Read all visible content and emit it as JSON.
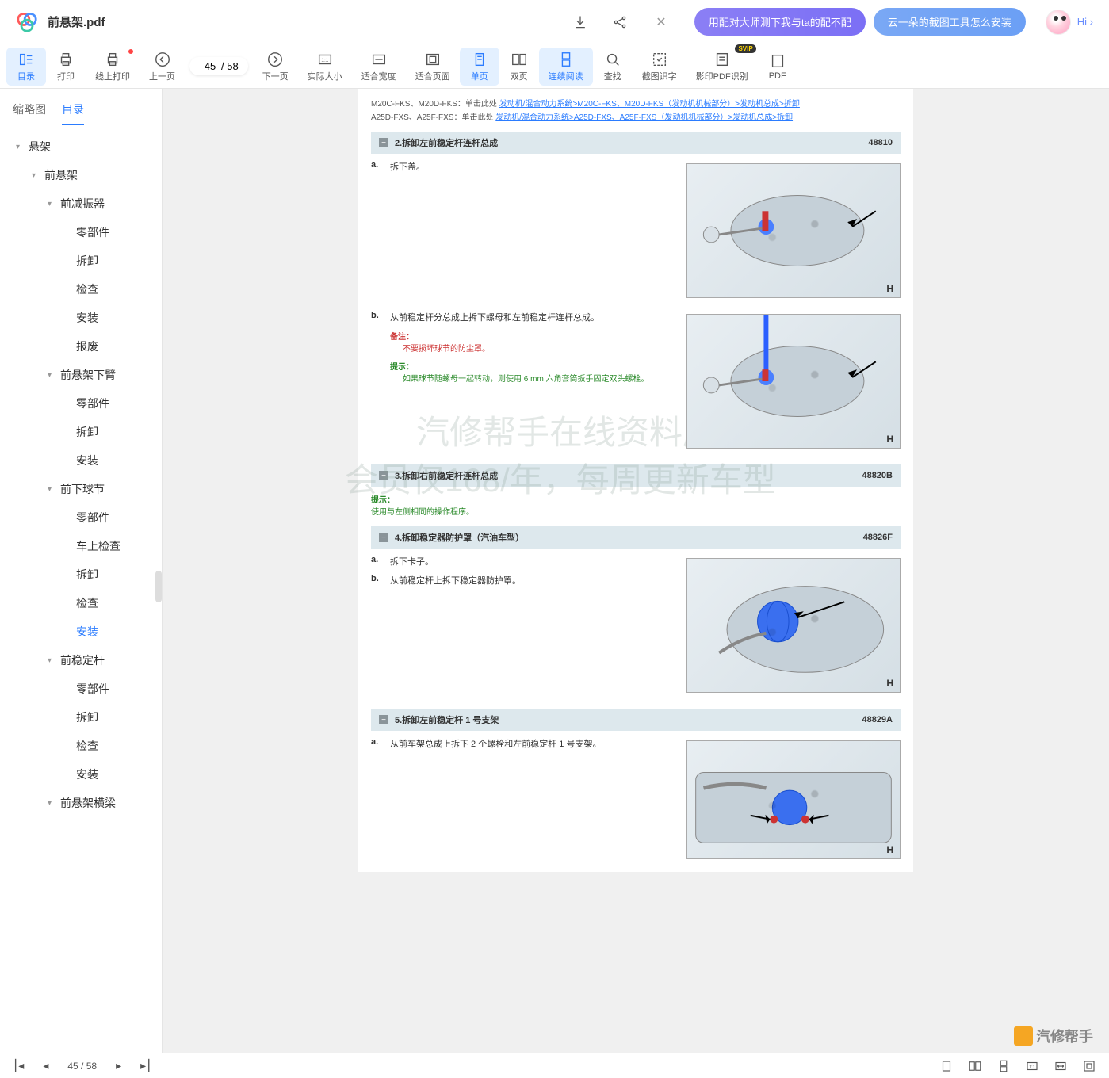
{
  "titlebar": {
    "filename": "前悬架.pdf",
    "promo1": "用配对大师测下我与ta的配不配",
    "promo2": "云一朵的截图工具怎么安装",
    "hi": "Hi"
  },
  "toolbar": {
    "items": [
      {
        "label": "目录",
        "active": true
      },
      {
        "label": "打印"
      },
      {
        "label": "线上打印",
        "dot": true
      },
      {
        "label": "上一页"
      },
      {
        "label": "下一页"
      },
      {
        "label": "实际大小"
      },
      {
        "label": "适合宽度"
      },
      {
        "label": "适合页面"
      },
      {
        "label": "单页",
        "active": true
      },
      {
        "label": "双页"
      },
      {
        "label": "连续阅读",
        "active": true
      },
      {
        "label": "查找"
      },
      {
        "label": "截图识字"
      },
      {
        "label": "影印PDF识别",
        "svip": true
      },
      {
        "label": "PDF"
      }
    ],
    "page_current": "45",
    "page_total": "58"
  },
  "sidebar": {
    "tabs": [
      "缩略图",
      "目录"
    ],
    "active_tab": 1,
    "tree": [
      {
        "level": 0,
        "label": "悬架",
        "caret": true
      },
      {
        "level": 1,
        "label": "前悬架",
        "caret": true
      },
      {
        "level": 2,
        "label": "前减振器",
        "caret": true
      },
      {
        "level": 3,
        "label": "零部件"
      },
      {
        "level": 3,
        "label": "拆卸"
      },
      {
        "level": 3,
        "label": "检查"
      },
      {
        "level": 3,
        "label": "安装"
      },
      {
        "level": 3,
        "label": "报废"
      },
      {
        "level": 2,
        "label": "前悬架下臂",
        "caret": true
      },
      {
        "level": 3,
        "label": "零部件"
      },
      {
        "level": 3,
        "label": "拆卸"
      },
      {
        "level": 3,
        "label": "安装"
      },
      {
        "level": 2,
        "label": "前下球节",
        "caret": true
      },
      {
        "level": 3,
        "label": "零部件"
      },
      {
        "level": 3,
        "label": "车上检查"
      },
      {
        "level": 3,
        "label": "拆卸"
      },
      {
        "level": 3,
        "label": "检查"
      },
      {
        "level": 3,
        "label": "安装",
        "selected": true
      },
      {
        "level": 2,
        "label": "前稳定杆",
        "caret": true
      },
      {
        "level": 3,
        "label": "零部件"
      },
      {
        "level": 3,
        "label": "拆卸"
      },
      {
        "level": 3,
        "label": "检查"
      },
      {
        "level": 3,
        "label": "安装"
      },
      {
        "level": 2,
        "label": "前悬架横梁",
        "caret": true
      }
    ]
  },
  "doc": {
    "ref1_prefix": "M20C-FKS、M20D-FKS：单击此处",
    "ref1_link": "发动机/混合动力系统>M20C-FKS、M20D-FKS（发动机机械部分）>发动机总成>拆卸",
    "ref2_prefix": "A25D-FXS、A25F-FXS：单击此处",
    "ref2_link": "发动机/混合动力系统>A25D-FXS、A25F-FXS（发动机机械部分）>发动机总成>拆卸",
    "sections": [
      {
        "title": "2.拆卸左前稳定杆连杆总成",
        "code": "48810"
      },
      {
        "title": "3.拆卸右前稳定杆连杆总成",
        "code": "48820B"
      },
      {
        "title": "4.拆卸稳定器防护罩（汽油车型）",
        "code": "48826F"
      },
      {
        "title": "5.拆卸左前稳定杆 1 号支架",
        "code": "48829A"
      }
    ],
    "steps": {
      "s2a": "拆下盖。",
      "s2b": "从前稳定杆分总成上拆下螺母和左前稳定杆连杆总成。",
      "note_label": "备注：",
      "note_text": "不要损坏球节的防尘罩。",
      "tip_label": "提示：",
      "tip_text": "如果球节随螺母一起转动，则使用 6 mm 六角套筒扳手固定双头螺栓。",
      "s3_tip_label": "提示：",
      "s3_tip": "使用与左侧相同的操作程序。",
      "s4a": "拆下卡子。",
      "s4b": "从前稳定杆上拆下稳定器防护罩。",
      "s5a": "从前车架总成上拆下 2 个螺栓和左前稳定杆 1 号支架。"
    },
    "watermark1": "汽修帮手在线资料库",
    "watermark2": "会员仅168/年，每周更新车型",
    "footer_brand": "汽修帮手"
  },
  "bottombar": {
    "page": "45 / 58"
  }
}
